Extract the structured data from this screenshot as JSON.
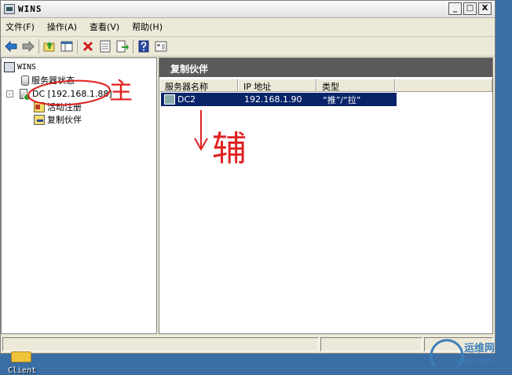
{
  "window": {
    "title": "WINS",
    "minimize": "_",
    "maximize": "□",
    "close": "X"
  },
  "menu": [
    "文件(F)",
    "操作(A)",
    "查看(V)",
    "帮助(H)"
  ],
  "toolbar": [
    "back-icon",
    "forward-icon",
    "up-icon",
    "show-hide-tree-icon",
    "delete-icon",
    "properties-icon",
    "export-icon",
    "help-icon",
    "console-icon"
  ],
  "tree": {
    "root": "WINS",
    "status": "服务器状态",
    "expander": "-",
    "server": "DC [192.168.1.88]",
    "active_registrations": "活动注册",
    "replication_partners": "复制伙伴"
  },
  "right_pane": {
    "header": "复制伙伴",
    "columns": [
      "服务器名称",
      "IP 地址",
      "类型"
    ],
    "rows": [
      {
        "name": "DC2",
        "ip": "192.168.1.90",
        "type": "“推”/“拉”"
      }
    ]
  },
  "annotations": {
    "primary": "主",
    "secondary": "辅"
  },
  "desktop": {
    "icon_label": "Client"
  },
  "watermark": {
    "brand": "运维网",
    "url": "iyunv.com"
  },
  "colors": {
    "selection": "#0a246a",
    "pane_header": "#5a5a5a",
    "annotation_red": "#e02020",
    "desktop": "#3a6ea5"
  }
}
